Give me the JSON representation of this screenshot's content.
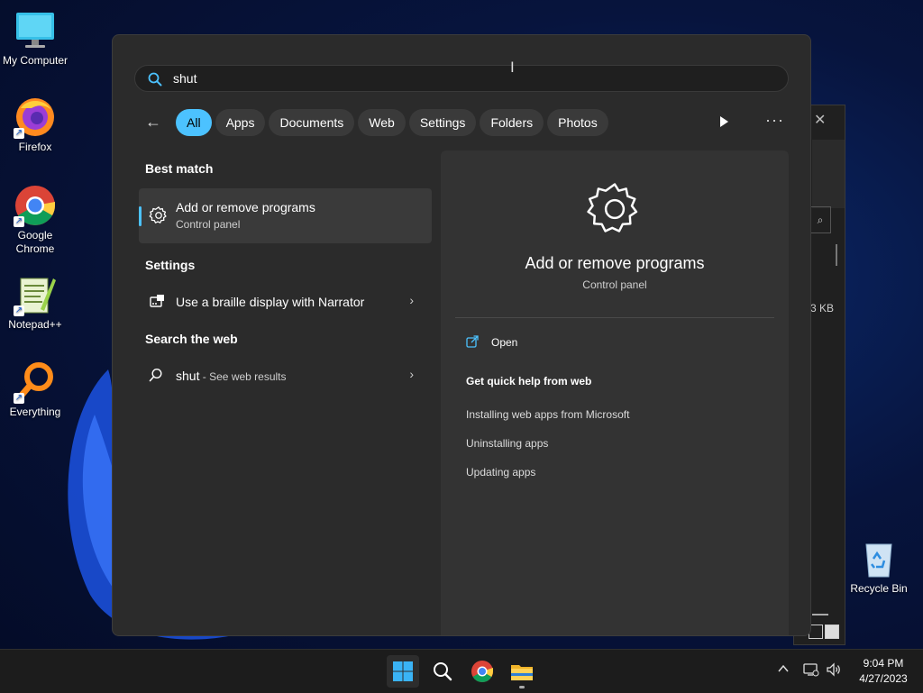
{
  "desktop": {
    "icons": [
      {
        "label": "My Computer"
      },
      {
        "label": "Firefox"
      },
      {
        "label": "Google Chrome"
      },
      {
        "label": "Notepad++"
      },
      {
        "label": "Everything"
      },
      {
        "label": "Recycle Bin"
      }
    ]
  },
  "background_window": {
    "close": "✕",
    "size_fragment": "3 KB"
  },
  "search": {
    "query": "shut"
  },
  "filters": {
    "back_icon": "arrow-left-icon",
    "chips": [
      "All",
      "Apps",
      "Documents",
      "Web",
      "Settings",
      "Folders",
      "Photos"
    ],
    "active": "All",
    "more": "···"
  },
  "results": {
    "best_match_heading": "Best match",
    "best_match": {
      "title": "Add or remove programs",
      "subtitle": "Control panel"
    },
    "settings_heading": "Settings",
    "settings_item": "Use a braille display with Narrator",
    "web_heading": "Search the web",
    "web_item": {
      "query": "shut",
      "suffix": " - See web results"
    }
  },
  "detail": {
    "title": "Add or remove programs",
    "subtitle": "Control panel",
    "open_label": "Open",
    "quick_help_heading": "Get quick help from web",
    "links": [
      "Installing web apps from Microsoft",
      "Uninstalling apps",
      "Updating apps"
    ]
  },
  "taskbar": {
    "time": "9:04 PM",
    "date": "4/27/2023"
  },
  "colors": {
    "accent": "#4cc2ff",
    "panel": "#2b2b2b",
    "taskbar": "#1c1c1c"
  }
}
